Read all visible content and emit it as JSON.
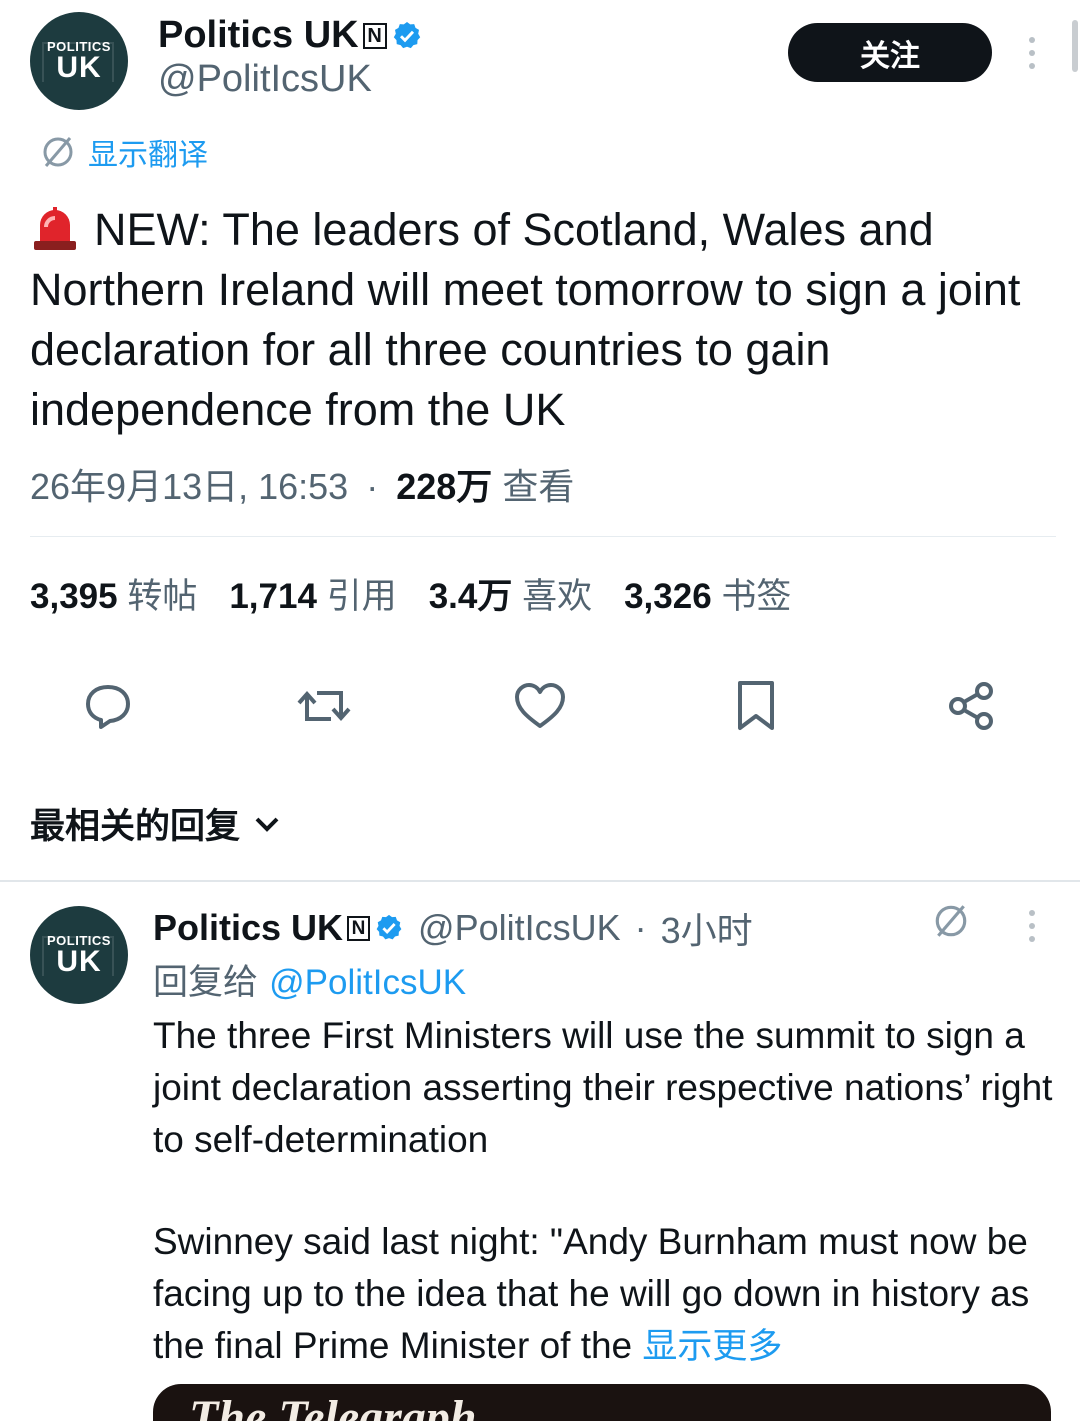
{
  "tweet": {
    "author_name": "Politics UK",
    "author_handle": "@PolitIcsUK",
    "avatar": {
      "top": "POLITICS",
      "main": "UK"
    },
    "follow_label": "关注",
    "translate_label": "显示翻译",
    "text": "NEW: The leaders of Scotland, Wales and Northern Ireland will meet tomorrow to sign a joint declaration for all three countries to gain independence from the UK",
    "emoji_icon": "police-siren-icon",
    "timestamp": "26年9月13日, 16:53",
    "separator": "·",
    "views_count": "228万",
    "views_label": "查看"
  },
  "stats": [
    {
      "count": "3,395",
      "label": "转帖"
    },
    {
      "count": "1,714",
      "label": "引用"
    },
    {
      "count": "3.4万",
      "label": "喜欢"
    },
    {
      "count": "3,326",
      "label": "书签"
    }
  ],
  "actions": [
    "reply-icon",
    "repost-icon",
    "like-icon",
    "bookmark-icon",
    "share-icon"
  ],
  "replies_sort_label": "最相关的回复",
  "reply": {
    "author_name": "Politics UK",
    "author_handle": "@PolitIcsUK",
    "separator": "·",
    "time": "3小时",
    "replying_to_label": "回复给",
    "replying_to_handle": "@PolitIcsUK",
    "paragraph1": "The three First Ministers will use the summit to sign a joint declaration asserting their respective nations’ right to self-determination",
    "paragraph2": "Swinney said last night: \"Andy Burnham must now be facing up to the idea that he will go down in history as the final Prime Minister of the",
    "show_more": "显示更多",
    "media_title": "The Telegraph"
  },
  "colors": {
    "accent": "#1d9bf0",
    "text": "#0f1419",
    "muted": "#536471",
    "avatar_bg": "#1d3b3f"
  }
}
